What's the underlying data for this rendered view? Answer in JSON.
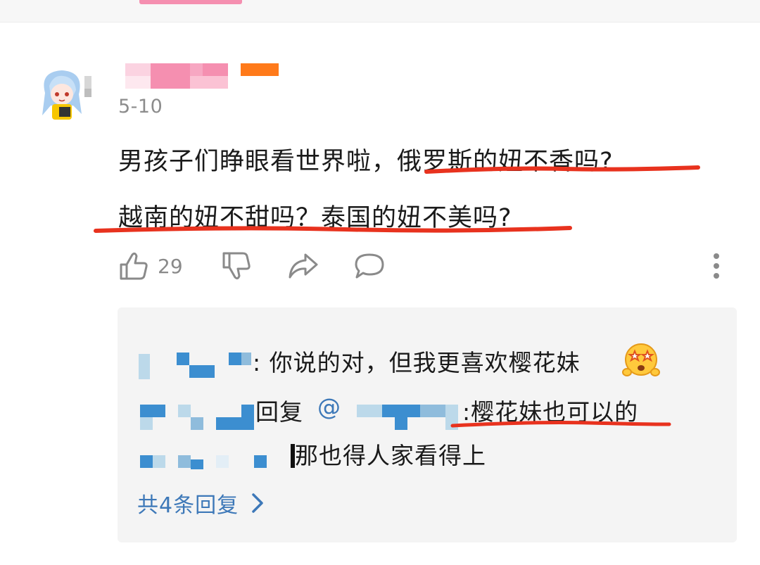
{
  "comment": {
    "date": "5-10",
    "text_line1_plain": "男孩子们睁眼看世界啦，",
    "text_line1_highlight": "俄罗斯的妞不香吗?",
    "text_line2": "越南的妞不甜吗？泰国的妞不美吗?",
    "like_count": "29"
  },
  "replies": {
    "reply1_text": ": 你说的对，但我更喜欢樱花妹",
    "reply2_prefix": "回复",
    "reply2_mention": "@",
    "reply2_text": ":樱花妹也可以的",
    "reply3_text": "那也得人家看得上",
    "view_all_label": "共4条回复"
  },
  "colors": {
    "accent_pink": "#f58fb0",
    "badge_orange": "#ff7a1a",
    "link_blue": "#3d78b8",
    "underline_red": "#e8321e",
    "reply_bg": "#f4f4f4"
  },
  "icons": [
    "thumbs-up-icon",
    "thumbs-down-icon",
    "share-icon",
    "comment-icon",
    "more-vertical-icon",
    "chevron-right-icon",
    "star-eyes-emoji-icon"
  ]
}
